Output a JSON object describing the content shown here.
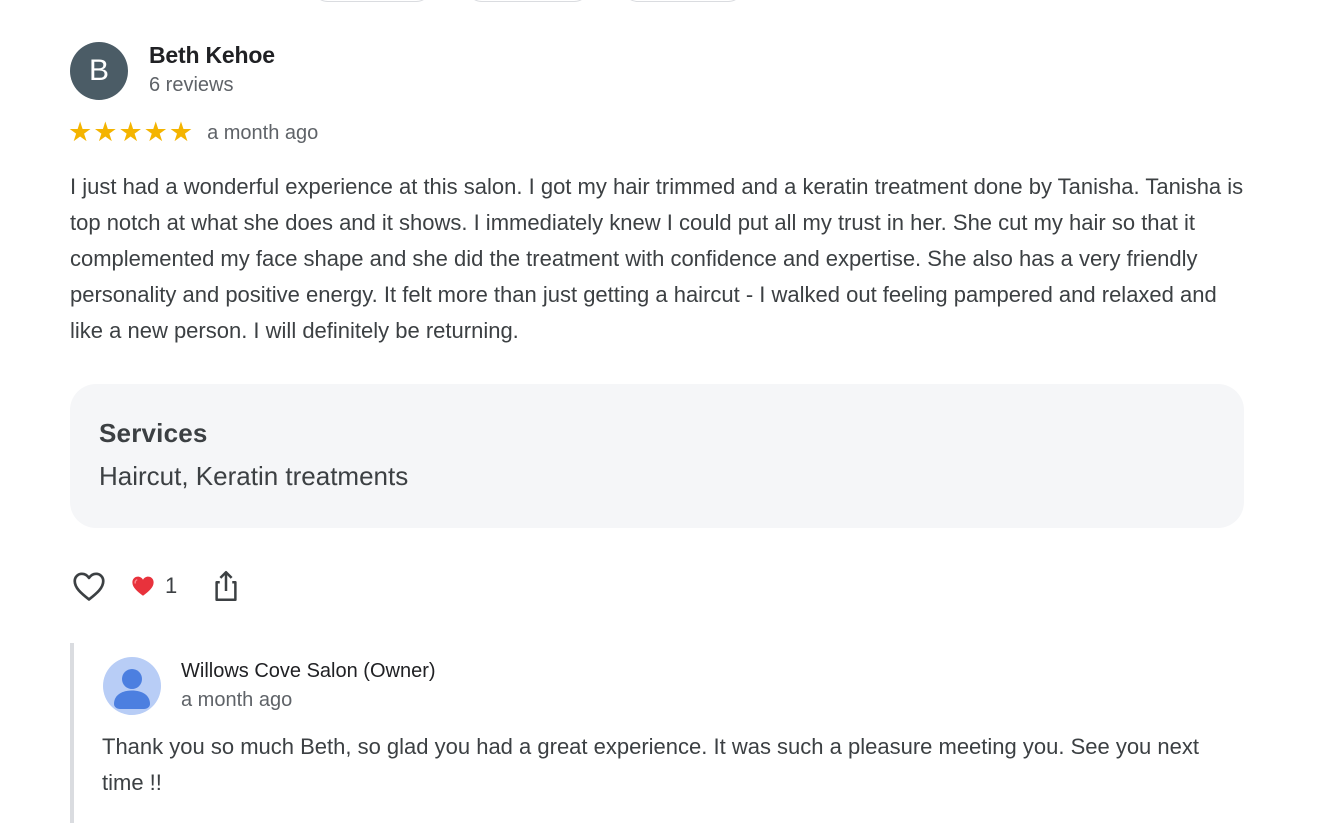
{
  "review": {
    "avatar_letter": "B",
    "author_name": "Beth Kehoe",
    "author_meta": "6 reviews",
    "rating": 5,
    "rating_max": 5,
    "date": "a month ago",
    "text": "I just had a wonderful experience at this salon. I got my hair trimmed and a keratin treatment done by Tanisha. Tanisha is top notch at what she does and it shows. I immediately knew I could put all my trust in her. She cut my hair so that it complemented my face shape and she did the treatment with confidence and expertise. She also has a very friendly personality and positive energy. It felt more than just getting a haircut - I walked out feeling pampered and relaxed and like a new person. I will definitely be returning."
  },
  "services": {
    "heading": "Services",
    "value": "Haircut, Keratin treatments"
  },
  "actions": {
    "like_icon": "heart-outline-icon",
    "reaction_emoji": "red-heart-emoji",
    "reaction_count": "1",
    "share_icon": "share-icon"
  },
  "owner_reply": {
    "name": "Willows Cove Salon (Owner)",
    "date": "a month ago",
    "text": "Thank you so much Beth, so glad you had a great experience. It was such a pleasure meeting you. See you next time !!"
  },
  "colors": {
    "avatar_bg": "#4b5c66",
    "star": "#f4b400",
    "services_bg": "#f5f6f8",
    "reaction_heart": "#e8323c",
    "owner_avatar": "#4c7fe0"
  }
}
